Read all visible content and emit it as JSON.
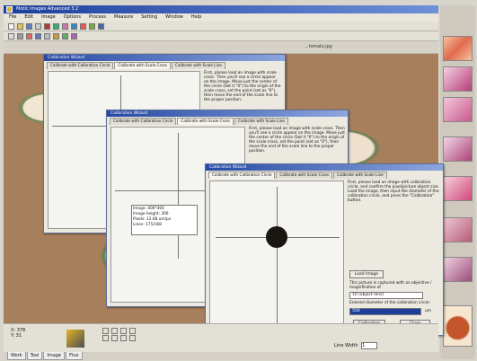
{
  "window": {
    "title": "Motic Images Advanced 3.2"
  },
  "menu": [
    "File",
    "Edit",
    "Image",
    "Options",
    "Process",
    "Measure",
    "Setting",
    "Window",
    "Help"
  ],
  "doc": {
    "filename": "...tomato.jpg"
  },
  "dialog": {
    "title": "Calibration Wizard",
    "tabs": [
      "Calibrate with Calibration Circle",
      "Calibrate with Scale Cross",
      "Calibrate with Scale Line"
    ],
    "instructions_scale": "First, please load an image with scale cross. Then you'll see a circle appear on the image. Move just the center of the circle (Set it \"0\") to the origin of the scale cross, set the point (set as \"0\"), then move the end of the scale line to the proper position.",
    "instructions_circle": "First, please load an image with calibration circle, and confirm the pixel/picture object size. Load the image, then input the diameter of the calibration circle, and press the \"Calibration\" button.",
    "load_button": "Load Image",
    "picture_label": "This picture is captured with an objective / magnification of",
    "objective_value": "10 (object lens)",
    "diameter_label": "Entered diameter of the calibration circle:",
    "diameter_value": "500",
    "unit": "um",
    "calibration_button": "Calibration",
    "close_button": "Close"
  },
  "dialog_info": {
    "line1": "Image: 400*300",
    "line2": "Image height: 300",
    "line3": "Pixels: 12.68 um/px",
    "line4": "Lines: 175/168"
  },
  "status": {
    "coord_x": "X: 378",
    "coord_y": "Y: 31",
    "line_width_label": "Line Width",
    "line_width_value": "1"
  },
  "bottom_tabs": [
    "Work",
    "Tool",
    "Image",
    "Fluo"
  ]
}
